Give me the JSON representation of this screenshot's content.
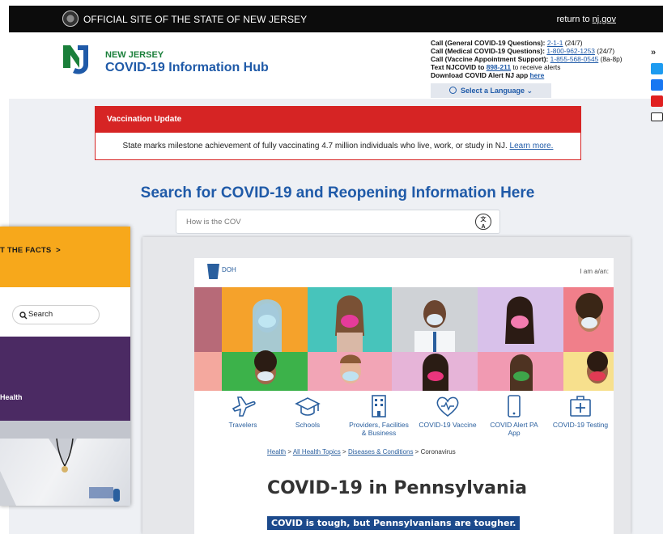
{
  "nj": {
    "topbar": {
      "official": "OFFICIAL SITE OF THE STATE OF NEW JERSEY",
      "return_prefix": "return to ",
      "return_link": "nj.gov"
    },
    "brand": {
      "state": "NEW JERSEY",
      "title": "COVID-19 Information Hub"
    },
    "contacts": {
      "general_label": "Call (General COVID-19 Questions):",
      "general_num": "2-1-1",
      "general_hours": "(24/7)",
      "medical_label": "Call (Medical COVID-19 Questions):",
      "medical_num": "1-800-962-1253",
      "medical_hours": "(24/7)",
      "vaccine_label": "Call (Vaccine Appointment Support):",
      "vaccine_num": "1-855-568-0545",
      "vaccine_hours": "(8a-8p)",
      "text_label": "Text NJCOVID to",
      "text_num": "898-211",
      "text_suffix": "to receive alerts",
      "app_label": "Download COVID Alert NJ app",
      "app_link": "here"
    },
    "language_label": "Select a Language",
    "alert": {
      "heading": "Vaccination Update",
      "body": "State marks milestone achievement of fully vaccinating 4.7 million individuals who live, work, or study in NJ.",
      "link": "Learn more."
    },
    "search": {
      "title": "Search for COVID-19 and Reopening Information Here",
      "value": "How is the COV"
    },
    "side_icons": [
      "chevron-right-icon",
      "twitter-icon",
      "facebook-icon",
      "youtube-icon",
      "email-icon"
    ]
  },
  "left_window": {
    "facts": "T THE FACTS",
    "search_label": "Search",
    "purple_text": "Health"
  },
  "pa": {
    "doh": "DOH",
    "iam": "I am a/an:",
    "nav": [
      {
        "icon": "airplane-icon",
        "label1": "Travelers",
        "label2": ""
      },
      {
        "icon": "graduation-cap-icon",
        "label1": "Schools",
        "label2": ""
      },
      {
        "icon": "building-icon",
        "label1": "Providers, Facilities",
        "label2": "& Business"
      },
      {
        "icon": "heart-vaccine-icon",
        "label1": "COVID-19 Vaccine",
        "label2": ""
      },
      {
        "icon": "phone-icon",
        "label1": "COVID Alert PA",
        "label2": "App"
      },
      {
        "icon": "medical-kit-icon",
        "label1": "COVID-19 Testing",
        "label2": ""
      }
    ],
    "breadcrumb": {
      "c1": "Health",
      "c2": "All Health Topics",
      "c3": "Diseases & Conditions",
      "c4": "Coronavirus",
      "sep": ">"
    },
    "title": "COVID-19 in Pennsylvania",
    "tagline": "COVID is tough, but Pennsylvanians are tougher."
  },
  "colors": {
    "nj_blue": "#1f5aa8",
    "nj_green": "#1a7f3a",
    "alert_red": "#d62424",
    "pa_blue": "#2a5f9e",
    "facts_orange": "#f7a81b",
    "purple": "#4b2a63"
  }
}
